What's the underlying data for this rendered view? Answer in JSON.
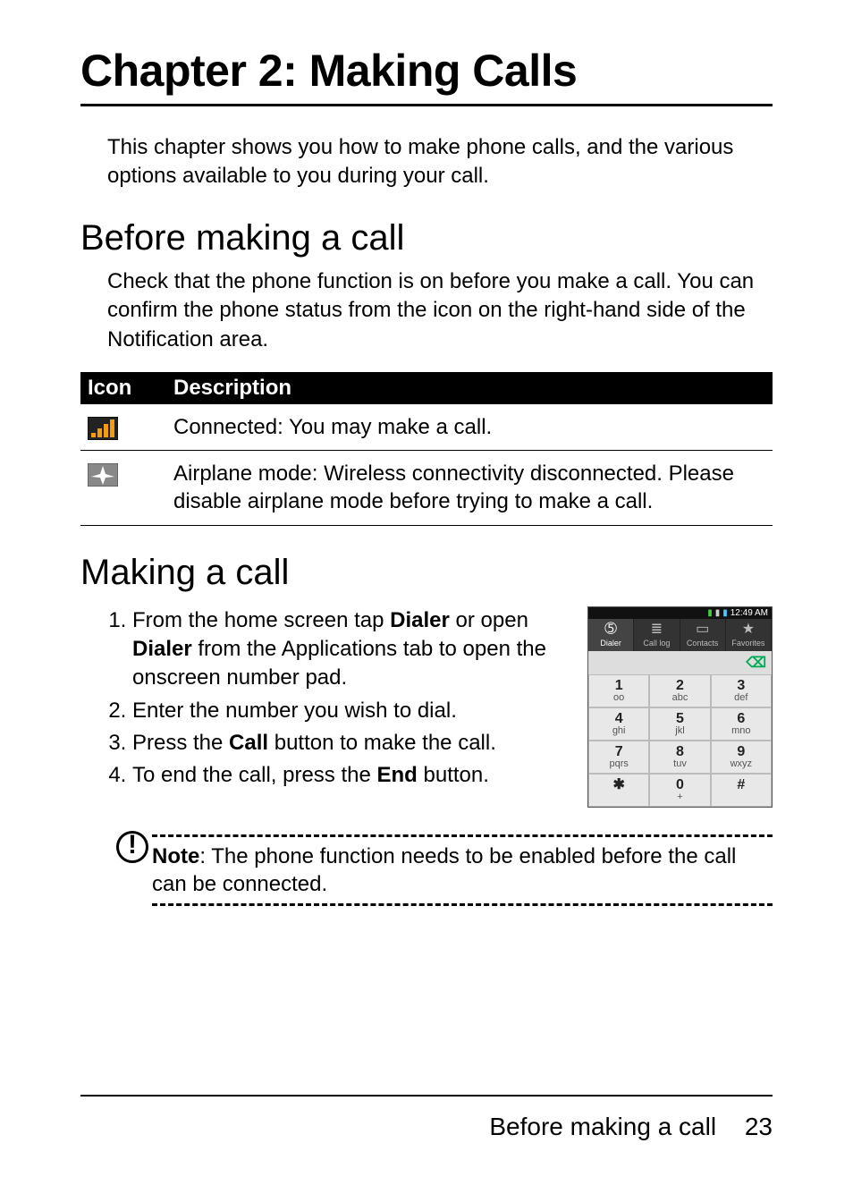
{
  "chapter_title": "Chapter 2: Making Calls",
  "intro": "This chapter shows you how to make phone calls, and the various options available to you during your call.",
  "section1": {
    "heading": "Before making a call",
    "body": "Check that the phone function is on before you make a call. You can confirm the phone status from the icon on the right-hand side of the Notification area."
  },
  "icon_table": {
    "header_icon": "Icon",
    "header_desc": "Description",
    "rows": [
      {
        "icon_name": "signal-connected-icon",
        "desc": "Connected: You may make a call."
      },
      {
        "icon_name": "airplane-mode-icon",
        "desc": "Airplane mode: Wireless connectivity disconnected. Please disable airplane mode before trying to make a call."
      }
    ]
  },
  "section2": {
    "heading": "Making a call",
    "step1_pre": "From the home screen tap ",
    "step1_b1": "Dialer",
    "step1_mid": " or open ",
    "step1_b2": "Dialer",
    "step1_post": " from the Applications tab to open the onscreen number pad.",
    "step2": "Enter the number you wish to dial.",
    "step3_pre": "Press the ",
    "step3_b": "Call",
    "step3_post": " button to make the call.",
    "step4_pre": "To end the call, press the ",
    "step4_b": "End",
    "step4_post": " button."
  },
  "note": {
    "label": "Note",
    "text": ": The phone function needs to be enabled before the call can be connected."
  },
  "dialer": {
    "time": "12:49 AM",
    "tabs": {
      "dialer": "Dialer",
      "calllog": "Call log",
      "contacts": "Contacts",
      "favorites": "Favorites"
    },
    "backspace_glyph": "⌫",
    "keys": [
      {
        "num": "1",
        "letters": "ᴏᴏ"
      },
      {
        "num": "2",
        "letters": "abc"
      },
      {
        "num": "3",
        "letters": "def"
      },
      {
        "num": "4",
        "letters": "ghi"
      },
      {
        "num": "5",
        "letters": "jkl"
      },
      {
        "num": "6",
        "letters": "mno"
      },
      {
        "num": "7",
        "letters": "pqrs"
      },
      {
        "num": "8",
        "letters": "tuv"
      },
      {
        "num": "9",
        "letters": "wxyz"
      },
      {
        "num": "✱",
        "letters": ""
      },
      {
        "num": "0",
        "letters": "+"
      },
      {
        "num": "#",
        "letters": ""
      }
    ]
  },
  "footer": {
    "section": "Before making a call",
    "page": "23"
  }
}
